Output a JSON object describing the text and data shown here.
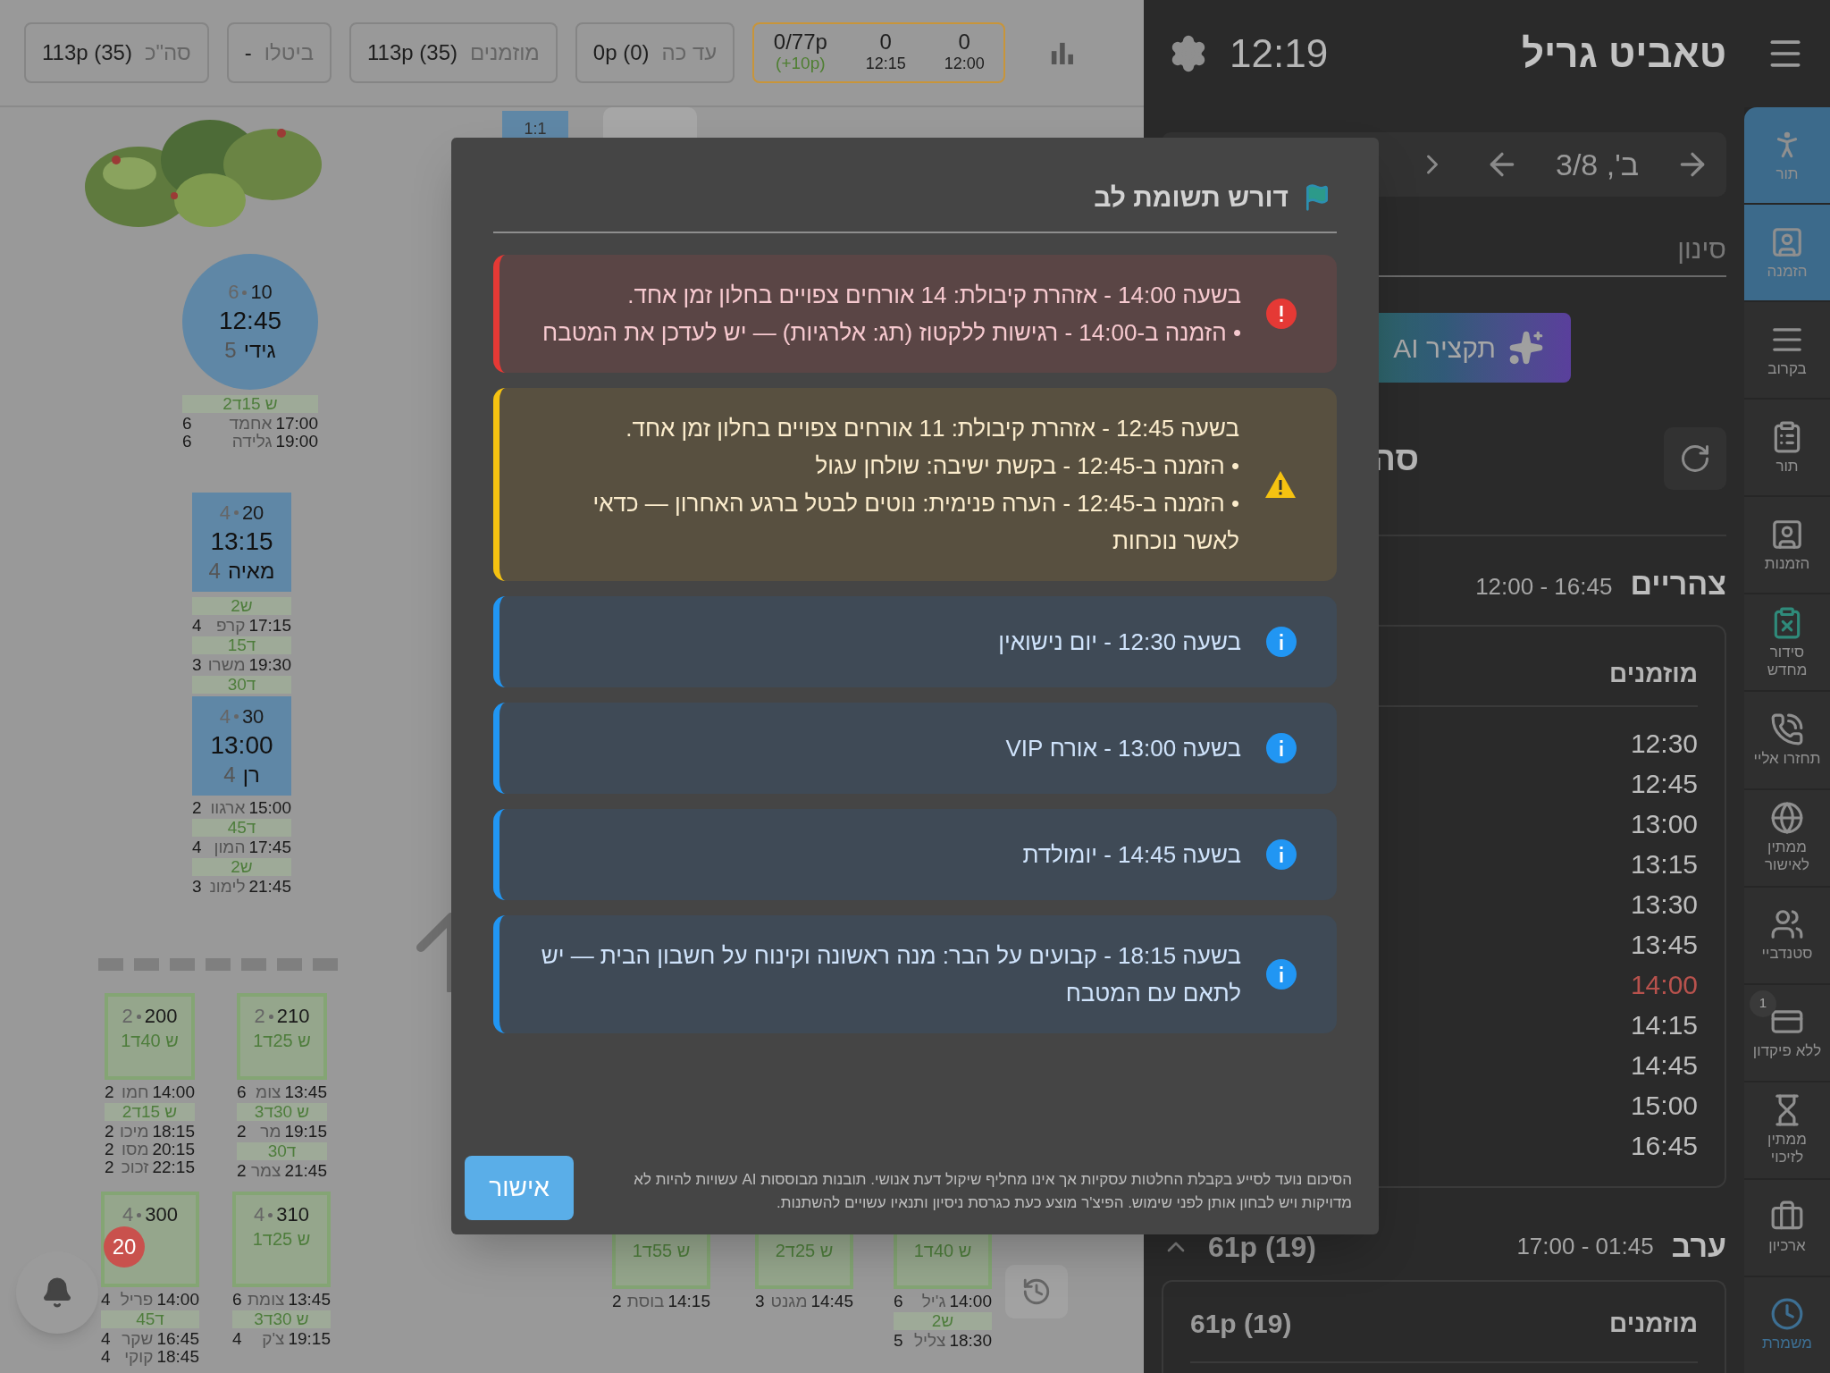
{
  "stats_bar": {
    "shift_box": {
      "slots": [
        {
          "count": "0",
          "time": "12:00"
        },
        {
          "count": "0",
          "time": "12:15"
        }
      ],
      "total": "0/77p",
      "extra": "(+10p)"
    },
    "boxes": [
      {
        "value": "0p (0)",
        "label": "עד כה"
      },
      {
        "value": "113p (35)",
        "label": "מוזמנים"
      },
      {
        "value": "-",
        "label": "ביטלו"
      },
      {
        "value": "113p (35)",
        "label": "סה\"כ"
      }
    ]
  },
  "floor_plan": {
    "small_table": "1:1",
    "tables": [
      {
        "kind": "round",
        "number": "10",
        "capacity": "6",
        "time": "12:45",
        "name": "גידי",
        "guests": "5",
        "bookings": [
          {
            "kind": "pill",
            "text": "2ש 15ד"
          },
          {
            "kind": "row",
            "time": "17:00",
            "name": "אחמד",
            "size": "6"
          },
          {
            "kind": "row",
            "time": "19:00",
            "name": "גלידה",
            "size": "6"
          }
        ]
      },
      {
        "kind": "square",
        "number": "20",
        "capacity": "4",
        "time": "13:15",
        "name": "מאיה",
        "guests": "4",
        "bookings": [
          {
            "kind": "pill",
            "text": "2ש"
          },
          {
            "kind": "row",
            "time": "17:15",
            "name": "קרפ",
            "size": "4"
          },
          {
            "kind": "pill",
            "text": "15ד"
          },
          {
            "kind": "row",
            "time": "19:30",
            "name": "משרו",
            "size": "3"
          },
          {
            "kind": "pill",
            "text": "30ד"
          }
        ]
      },
      {
        "kind": "square",
        "number": "30",
        "capacity": "4",
        "time": "13:00",
        "name": "רן",
        "guests": "4",
        "bookings": [
          {
            "kind": "row",
            "time": "15:00",
            "name": "ארגוו",
            "size": "2"
          },
          {
            "kind": "pill",
            "text": "45ד"
          },
          {
            "kind": "row",
            "time": "17:45",
            "name": "המון",
            "size": "4"
          },
          {
            "kind": "pill",
            "text": "2ש"
          },
          {
            "kind": "row",
            "time": "21:45",
            "name": "לימונ",
            "size": "3"
          }
        ]
      },
      {
        "kind": "outline",
        "number": "210",
        "capacity": "2",
        "duration": "1ש 25ד",
        "bookings": [
          {
            "kind": "row",
            "time": "13:45",
            "name": "צומ",
            "size": "6"
          },
          {
            "kind": "pill",
            "text": "3ש 30ד"
          },
          {
            "kind": "row",
            "time": "19:15",
            "name": "מר",
            "size": "2"
          },
          {
            "kind": "pill",
            "text": "30ד"
          },
          {
            "kind": "row",
            "time": "21:45",
            "name": "צמר",
            "size": "2"
          }
        ]
      },
      {
        "kind": "outline",
        "number": "200",
        "capacity": "2",
        "duration": "1ש 40ד",
        "bookings": [
          {
            "kind": "row",
            "time": "14:00",
            "name": "חמו",
            "size": "2"
          },
          {
            "kind": "pill",
            "text": "2ש 15ד"
          },
          {
            "kind": "row",
            "time": "18:15",
            "name": "מיכו",
            "size": "2"
          },
          {
            "kind": "row",
            "time": "20:15",
            "name": "מסו",
            "size": "2"
          },
          {
            "kind": "row",
            "time": "22:15",
            "name": "זכוכ",
            "size": "2"
          }
        ]
      },
      {
        "kind": "outline",
        "duration": "1ש 40ד",
        "bookings": [
          {
            "kind": "row",
            "time": "14:00",
            "name": "ג'יל",
            "size": "6"
          },
          {
            "kind": "pill",
            "text": "2ש"
          },
          {
            "kind": "row",
            "time": "18:30",
            "name": "צליל",
            "size": "5"
          }
        ]
      },
      {
        "kind": "outline",
        "duration": "2ש 25ד",
        "bookings": [
          {
            "kind": "row",
            "time": "14:45",
            "name": "מגנט",
            "size": "3"
          }
        ]
      },
      {
        "kind": "outline",
        "duration": "1ש 55ד",
        "bookings": [
          {
            "kind": "row",
            "time": "14:15",
            "name": "בוסת",
            "size": "2"
          }
        ]
      },
      {
        "kind": "outline",
        "number": "310",
        "capacity": "4",
        "duration": "1ש 25ד",
        "bookings": [
          {
            "kind": "row",
            "time": "13:45",
            "name": "צומת",
            "size": "6"
          },
          {
            "kind": "pill",
            "text": "3ש 30ד"
          },
          {
            "kind": "row",
            "time": "19:15",
            "name": "צ'ק",
            "size": "4"
          }
        ]
      },
      {
        "kind": "outline",
        "number": "300",
        "capacity": "4",
        "bookings": [
          {
            "kind": "row",
            "time": "14:00",
            "name": "פריל",
            "size": "4"
          },
          {
            "kind": "pill",
            "text": "45ד"
          },
          {
            "kind": "row",
            "time": "16:45",
            "name": "שקר",
            "size": "4"
          },
          {
            "kind": "row",
            "time": "18:45",
            "name": "קוקי",
            "size": "4"
          }
        ]
      }
    ],
    "notifications_badge": "20"
  },
  "header": {
    "time": "12:19",
    "title": "טאביט גריל"
  },
  "date_nav": {
    "date": "ב', 3/8"
  },
  "filter": {
    "placeholder": "סינון"
  },
  "ai_summary_button": "תקציר AI",
  "summary_heading": "סה",
  "shifts": [
    {
      "name": "צהריים",
      "hours": "12:00 - 16:45",
      "card_title": "מוזמנים",
      "times": [
        {
          "time": "12:30",
          "highlighted": false
        },
        {
          "time": "12:45",
          "highlighted": false
        },
        {
          "time": "13:00",
          "highlighted": false
        },
        {
          "time": "13:15",
          "highlighted": false
        },
        {
          "time": "13:30",
          "highlighted": false
        },
        {
          "time": "13:45",
          "highlighted": false
        },
        {
          "time": "14:00",
          "highlighted": true
        },
        {
          "time": "14:15",
          "highlighted": false
        },
        {
          "time": "14:45",
          "highlighted": false
        },
        {
          "time": "15:00",
          "highlighted": false
        },
        {
          "time": "16:45",
          "highlighted": false
        }
      ]
    },
    {
      "name": "ערב",
      "hours": "17:00 - 01:45",
      "total": "61p (19)",
      "card_title": "מוזמנים",
      "card_total": "61p (19)"
    }
  ],
  "nav": [
    {
      "label": "תור",
      "selected": true
    },
    {
      "label": "הזמנה",
      "selected": true
    },
    {
      "label": "בקרוב",
      "selected": false
    },
    {
      "label": "תור",
      "selected": false
    },
    {
      "label": "הזמנות",
      "selected": false
    },
    {
      "label": "סידור מחדש",
      "selected": false
    },
    {
      "label": "תחזרו אליי",
      "selected": false
    },
    {
      "label": "ממתין לאישור",
      "selected": false
    },
    {
      "label": "סטנדביי",
      "selected": false
    },
    {
      "label": "ללא פיקדון",
      "badge": "1",
      "selected": false
    },
    {
      "label": "ממתין לזיכוי",
      "selected": false
    },
    {
      "label": "ארכיון",
      "selected": false
    },
    {
      "label": "משמרת",
      "selected": false
    }
  ],
  "modal": {
    "title": "דורש תשומת לב",
    "alerts": [
      {
        "kind": "error",
        "lines": [
          "בשעה 14:00 - אזהרת קיבולת: 14 אורחים צפויים בחלון זמן אחד.",
          "• הזמנה ב-14:00 - רגישות ללקטוז (תג: אלרגיות) — יש לעדכן את המטבח"
        ]
      },
      {
        "kind": "warning",
        "lines": [
          "בשעה 12:45 - אזהרת קיבולת: 11 אורחים צפויים בחלון זמן אחד.",
          "• הזמנה ב-12:45 - בקשת ישיבה: שולחן עגול",
          "• הזמנה ב-12:45 - הערה פנימית: נוטים לבטל ברגע האחרון — כדאי לאשר נוכחות"
        ]
      },
      {
        "kind": "info",
        "lines": [
          "בשעה 12:30 - יום נישואין"
        ]
      },
      {
        "kind": "info",
        "lines": [
          "בשעה 13:00 - אורח VIP"
        ]
      },
      {
        "kind": "info",
        "lines": [
          "בשעה 14:45 - יומולדת"
        ]
      },
      {
        "kind": "info",
        "lines": [
          "בשעה 18:15 - קבועים על הבר: מנה ראשונה וקינוח על חשבון הבית — יש לתאם עם המטבח"
        ]
      }
    ],
    "disclaimer": "הסיכום נועד לסייע בקבלת החלטות עסקיות אך אינו מחליף שיקול דעת אנושי. תובנות מבוססות AI עשויות להיות לא מדויקות ויש לבחון אותן לפני שימוש. הפיצ'ר מוצע כעת כגרסת ניסיון ותנאיו עשויים להשתנות.",
    "confirm_button": "אישור"
  }
}
